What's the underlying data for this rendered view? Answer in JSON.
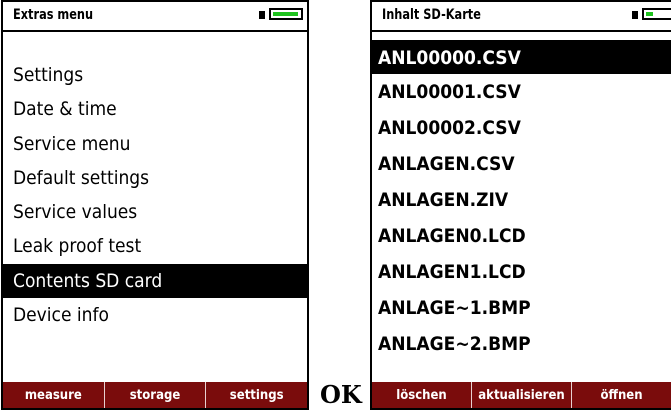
{
  "left": {
    "title": "Extras menu",
    "battery_level": 0.95,
    "items": [
      {
        "label": "Settings"
      },
      {
        "label": "Date & time"
      },
      {
        "label": "Service menu"
      },
      {
        "label": "Default settings"
      },
      {
        "label": "Service values"
      },
      {
        "label": "Leak proof test"
      },
      {
        "label": "Contents SD card",
        "selected": true
      },
      {
        "label": "Device info"
      }
    ],
    "softkeys": [
      "measure",
      "storage",
      "settings"
    ]
  },
  "ok_label": "OK",
  "right": {
    "title": "Inhalt SD-Karte",
    "battery_level": 0.25,
    "files": [
      {
        "label": "ANL00000.CSV",
        "selected": true
      },
      {
        "label": "ANL00001.CSV"
      },
      {
        "label": "ANL00002.CSV"
      },
      {
        "label": "ANLAGEN.CSV"
      },
      {
        "label": "ANLAGEN.ZIV"
      },
      {
        "label": "ANLAGEN0.LCD"
      },
      {
        "label": "ANLAGEN1.LCD"
      },
      {
        "label": "ANLAGE~1.BMP"
      },
      {
        "label": "ANLAGE~2.BMP"
      }
    ],
    "softkeys": [
      "löschen",
      "aktualisieren",
      "öffnen"
    ]
  },
  "colors": {
    "softkey_bar": "#7a0c0c",
    "battery_fill": "#1ec21e",
    "selection": "#000000"
  },
  "icons": {
    "battery": "battery-icon"
  }
}
